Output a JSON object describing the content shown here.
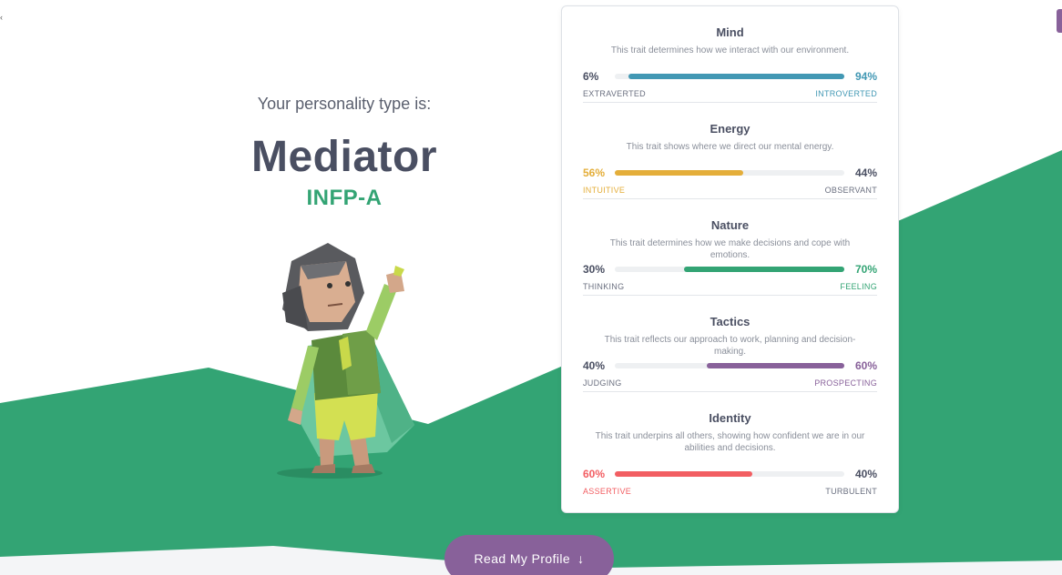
{
  "hero": {
    "intro": "Your personality type is:",
    "type_name": "Mediator",
    "type_code": "INFP-A"
  },
  "colors": {
    "green": "#33a474",
    "purple": "#88619a",
    "blue": "#4298b4",
    "yellow": "#e4ae3a",
    "red": "#f25e62",
    "text": "#4a4f62"
  },
  "traits": [
    {
      "title": "Mind",
      "description": "This trait determines how we interact with our environment.",
      "left_pct": "6%",
      "right_pct": "94%",
      "left_label": "EXTRAVERTED",
      "right_label": "INTROVERTED",
      "dominant": "right",
      "fill_fraction": 0.94,
      "color": "#4298b4"
    },
    {
      "title": "Energy",
      "description": "This trait shows where we direct our mental energy.",
      "left_pct": "56%",
      "right_pct": "44%",
      "left_label": "INTUITIVE",
      "right_label": "OBSERVANT",
      "dominant": "left",
      "fill_fraction": 0.56,
      "color": "#e4ae3a"
    },
    {
      "title": "Nature",
      "description": "This trait determines how we make decisions and cope with emotions.",
      "left_pct": "30%",
      "right_pct": "70%",
      "left_label": "THINKING",
      "right_label": "FEELING",
      "dominant": "right",
      "fill_fraction": 0.7,
      "color": "#33a474"
    },
    {
      "title": "Tactics",
      "description": "This trait reflects our approach to work, planning and decision-making.",
      "left_pct": "40%",
      "right_pct": "60%",
      "left_label": "JUDGING",
      "right_label": "PROSPECTING",
      "dominant": "right",
      "fill_fraction": 0.6,
      "color": "#88619a"
    },
    {
      "title": "Identity",
      "description": "This trait underpins all others, showing how confident we are in our abilities and decisions.",
      "left_pct": "60%",
      "right_pct": "40%",
      "left_label": "ASSERTIVE",
      "right_label": "TURBULENT",
      "dominant": "left",
      "fill_fraction": 0.6,
      "color": "#f25e62"
    }
  ],
  "cta": {
    "label": "Read My Profile",
    "icon": "arrow-down-icon"
  }
}
